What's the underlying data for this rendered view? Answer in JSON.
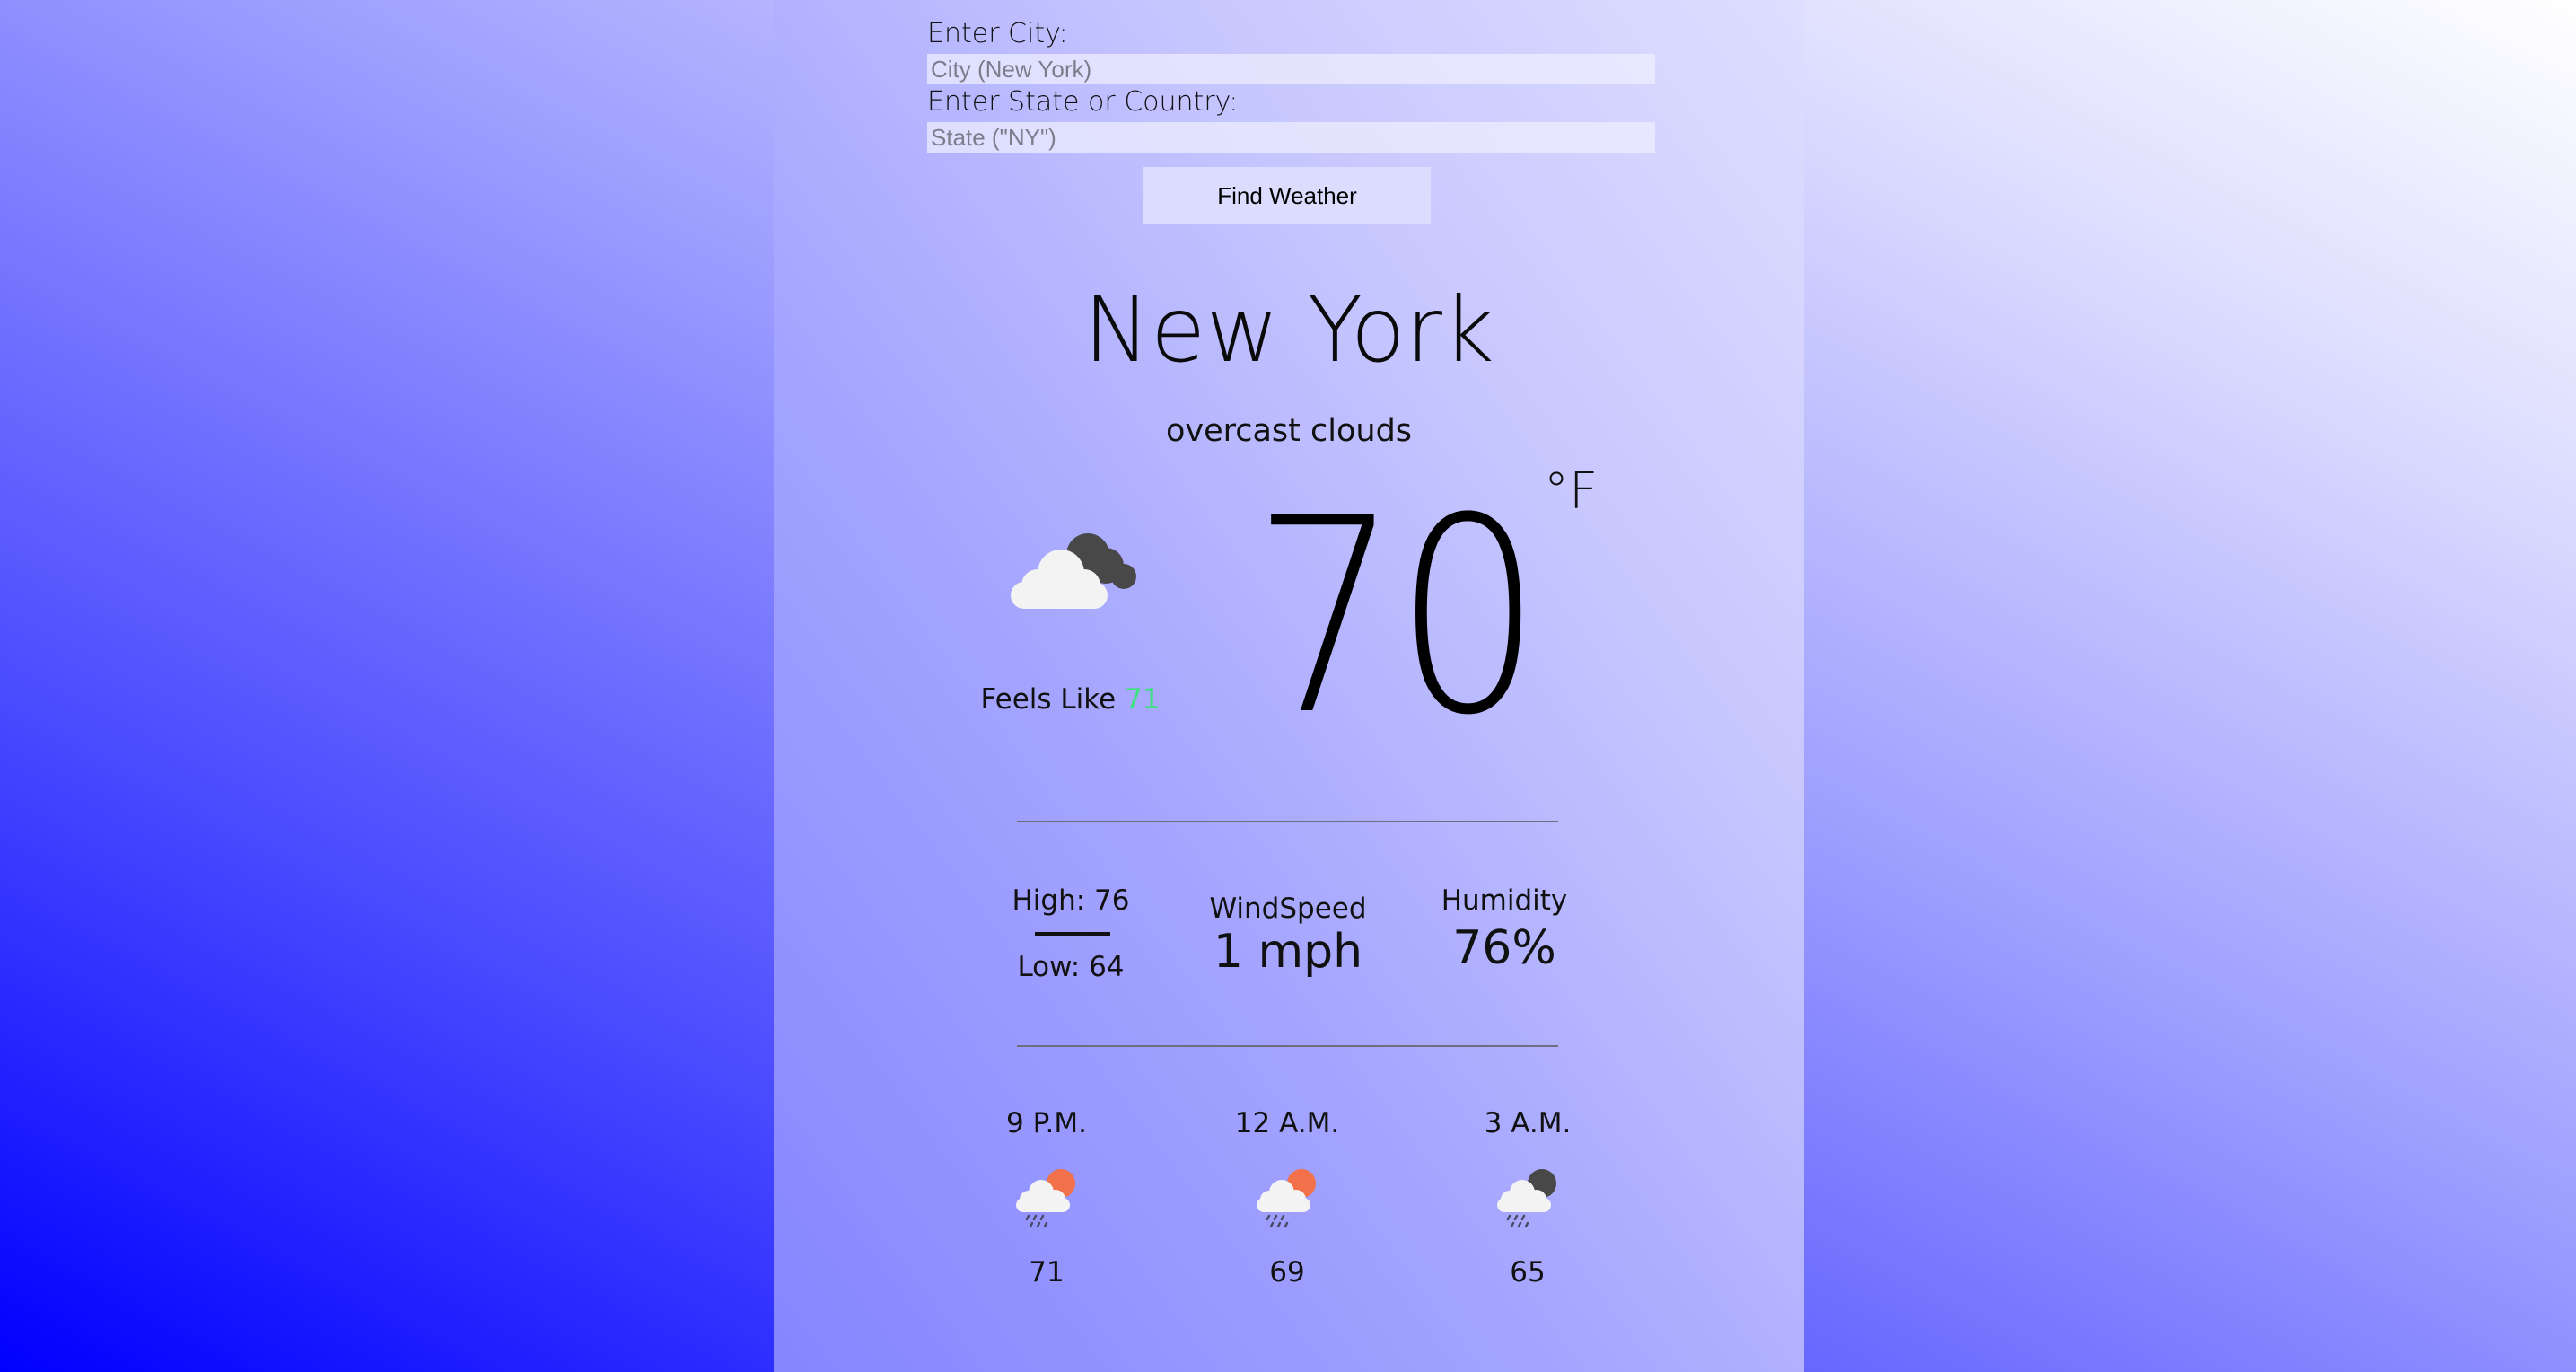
{
  "form": {
    "city_label": "Enter City:",
    "city_placeholder": "City (New York)",
    "state_label": "Enter State or Country:",
    "state_placeholder": "State (\"NY\")",
    "submit_label": "Find Weather"
  },
  "current": {
    "city": "New York",
    "description": "overcast clouds",
    "icon": "overcast-clouds-icon",
    "temperature": "70",
    "unit": "°F",
    "feels_like_label": "Feels Like",
    "feels_like_value": "71"
  },
  "stats": {
    "high": "High: 76",
    "low": "Low: 64",
    "wind_label": "WindSpeed",
    "wind_value": "1 mph",
    "humidity_label": "Humidity",
    "humidity_value": "76%"
  },
  "forecast": [
    {
      "time": "9 P.M.",
      "temp": "71",
      "icon": "rain-sun-icon"
    },
    {
      "time": "12 A.M.",
      "temp": "69",
      "icon": "rain-sun-icon"
    },
    {
      "time": "3 A.M.",
      "temp": "65",
      "icon": "rain-cloud-icon"
    }
  ],
  "colors": {
    "feels_like_value": "#3be27d",
    "sun": "#f2704a",
    "dark_cloud": "#484848"
  }
}
